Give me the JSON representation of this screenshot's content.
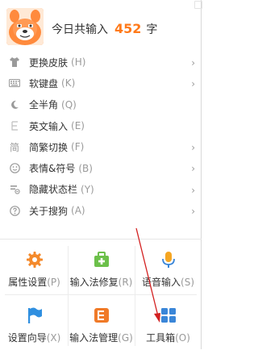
{
  "header": {
    "greeting": "今日共输入",
    "count": "452",
    "unit": "字"
  },
  "menu": [
    {
      "label": "更换皮肤",
      "key": "(H)",
      "icon": "shirt-icon",
      "submenu": true
    },
    {
      "label": "软键盘",
      "key": "(K)",
      "icon": "keyboard-icon",
      "submenu": true
    },
    {
      "label": "全半角",
      "key": "(Q)",
      "icon": "moon-icon",
      "submenu": false
    },
    {
      "label": "英文输入",
      "key": "(E)",
      "icon": "english-e-icon",
      "submenu": false
    },
    {
      "label": "简繁切换",
      "key": "(F)",
      "icon": "simplified-traditional-icon",
      "submenu": true
    },
    {
      "label": "表情&符号",
      "key": "(B)",
      "icon": "smiley-icon",
      "submenu": true
    },
    {
      "label": "隐藏状态栏",
      "key": "(Y)",
      "icon": "statusbar-icon",
      "submenu": true
    },
    {
      "label": "关于搜狗",
      "key": "(A)",
      "icon": "help-icon",
      "submenu": true
    }
  ],
  "grid": [
    {
      "label": "属性设置",
      "key": "(P)",
      "icon": "gear-icon"
    },
    {
      "label": "输入法修复",
      "key": "(R)",
      "icon": "repair-kit-icon"
    },
    {
      "label": "语音输入",
      "key": "(S)",
      "icon": "microphone-icon"
    },
    {
      "label": "设置向导",
      "key": "(X)",
      "icon": "flag-icon"
    },
    {
      "label": "输入法管理",
      "key": "(G)",
      "icon": "manager-icon"
    },
    {
      "label": "工具箱",
      "key": "(O)",
      "icon": "toolbox-grid-icon"
    }
  ],
  "colors": {
    "accent": "#ff7a1a",
    "gear": "#f48a2c",
    "repair": "#6cc04a",
    "mic": "#f5a623",
    "flag": "#2f8fe0",
    "manager": "#f07a28",
    "toolbox": "#3a86d8",
    "arrow": "#d32020"
  }
}
